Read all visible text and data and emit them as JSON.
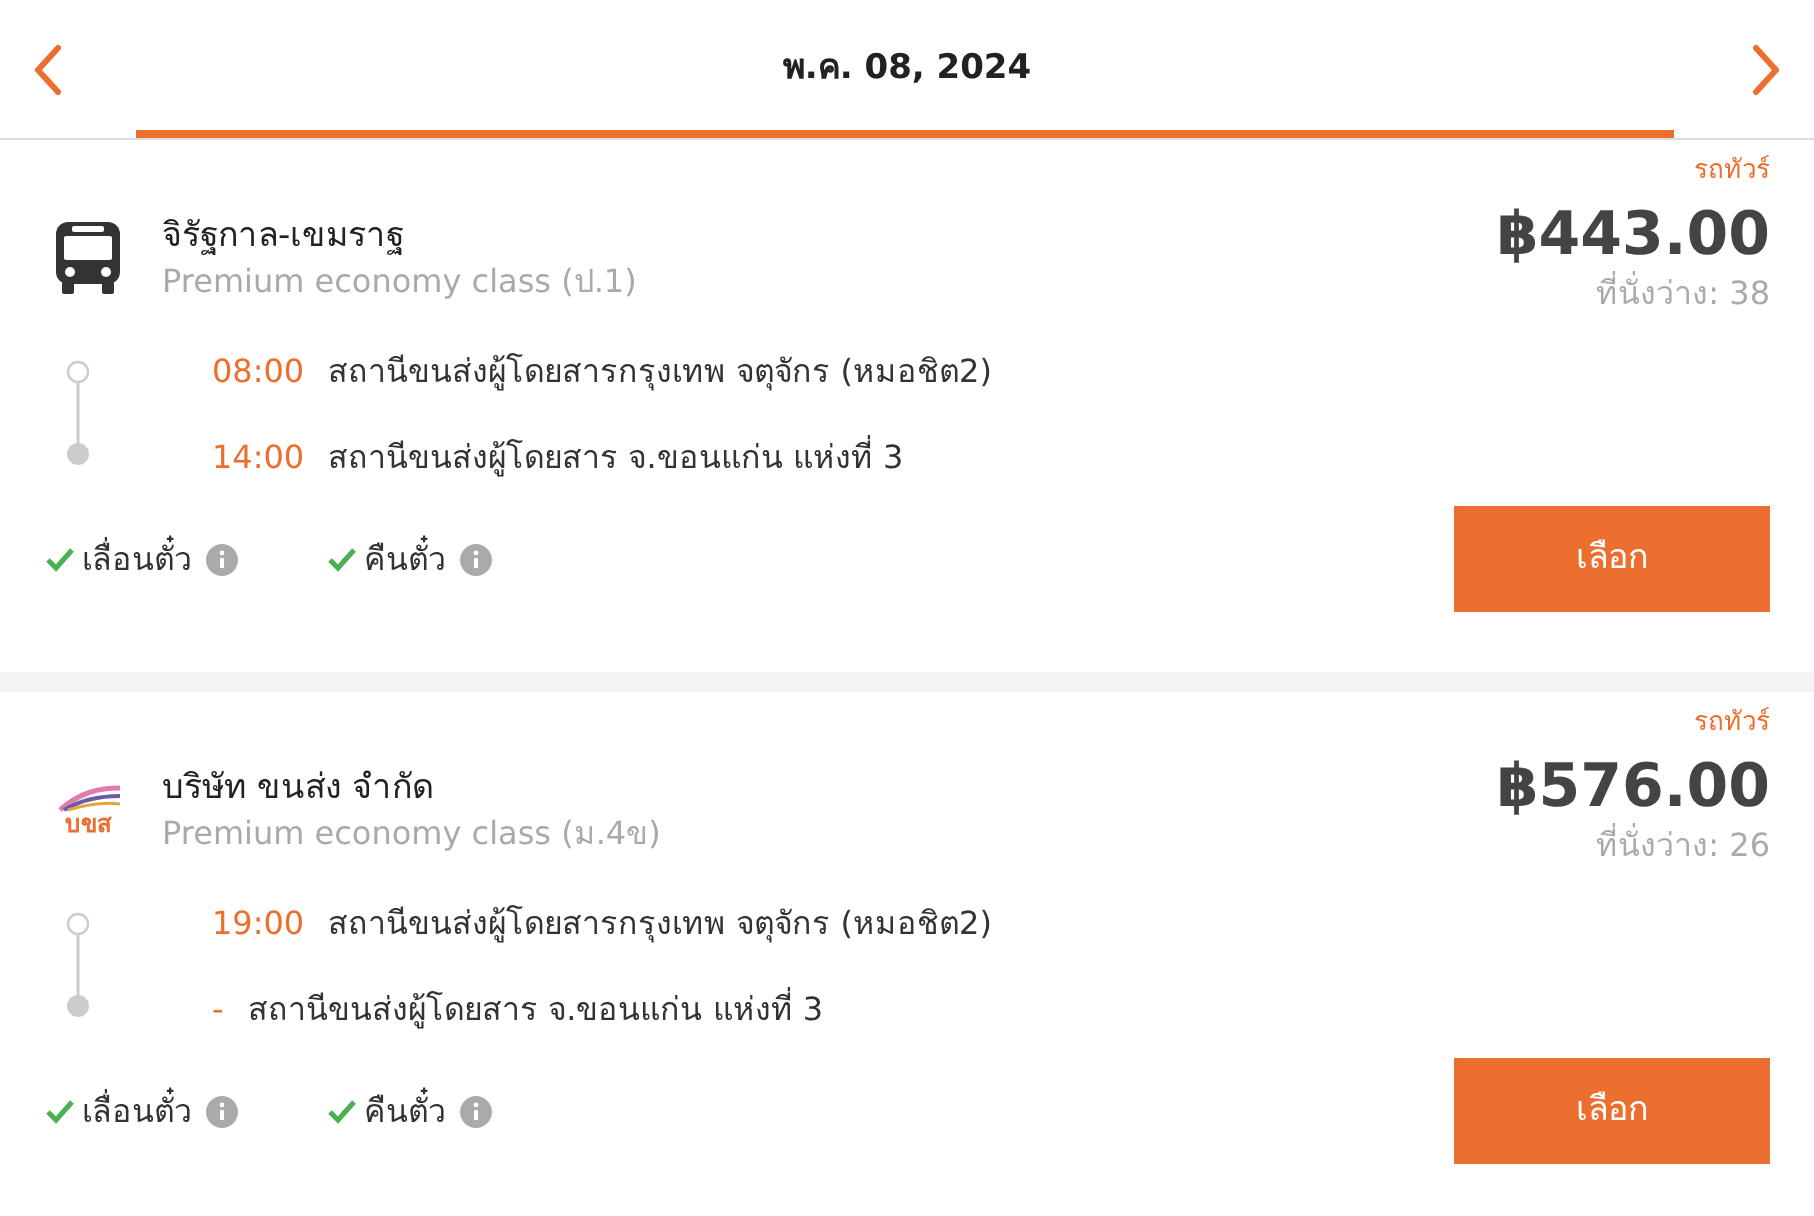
{
  "header": {
    "date": "พ.ค. 08, 2024"
  },
  "trips": [
    {
      "tag": "รถทัวร์",
      "logo": {
        "kind": "bus"
      },
      "operator": "จิรัฐกาล-เขมราฐ",
      "class": "Premium economy class (ป.1)",
      "price": "฿443.00",
      "seats": "ที่นั่งว่าง: 38",
      "stops": [
        {
          "time": "08:00",
          "station": "สถานีขนส่งผู้โดยสารกรุงเทพ จตุจักร (หมอชิต2)"
        },
        {
          "time": "14:00",
          "station": "สถานีขนส่งผู้โดยสาร จ.ขอนแก่น แห่งที่ 3"
        }
      ],
      "features": [
        {
          "label": "เลื่อนตั๋ว",
          "checked": true
        },
        {
          "label": "คืนตั๋ว",
          "checked": true
        }
      ],
      "button": "เลือก"
    },
    {
      "tag": "รถทัวร์",
      "logo": {
        "kind": "brand",
        "text": "บขส"
      },
      "operator": "บริษัท ขนส่ง จำกัด",
      "class": "Premium economy class (ม.4ข)",
      "price": "฿576.00",
      "seats": "ที่นั่งว่าง: 26",
      "stops": [
        {
          "time": "19:00",
          "station": "สถานีขนส่งผู้โดยสารกรุงเทพ จตุจักร (หมอชิต2)"
        },
        {
          "time": "-",
          "station": "สถานีขนส่งผู้โดยสาร จ.ขอนแก่น แห่งที่ 3"
        }
      ],
      "features": [
        {
          "label": "เลื่อนตั๋ว",
          "checked": true
        },
        {
          "label": "คืนตั๋ว",
          "checked": true
        }
      ],
      "button": "เลือก"
    }
  ]
}
